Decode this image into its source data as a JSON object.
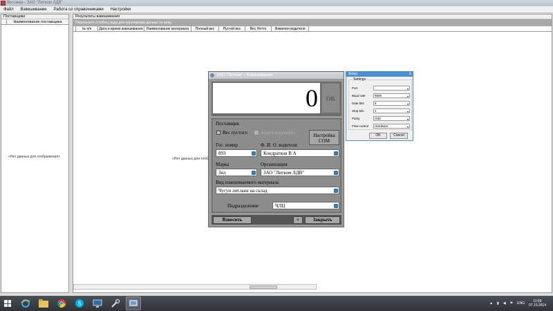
{
  "app": {
    "title": "Весовая - ЗАО \"Литком ЛДВ\"",
    "menu": [
      "Файл",
      "Взвешивание",
      "Работа со справочниками",
      "Настройки"
    ]
  },
  "suppliers": {
    "caption": "Поставщики",
    "column": "Наименование поставщика",
    "empty": "<Нет данных для отображения>"
  },
  "results": {
    "caption": "Результаты взвешивания",
    "group_hint": "Перенесите столбец сюда для группировки данных по нему",
    "columns": [
      "№ п/п",
      "Дата и время взвешивания",
      "Наименование материала",
      "Полный вес",
      "Пустой вес",
      "Вес Нетто",
      "Фамилия водителя"
    ],
    "empty": "<Нет данных для отоб"
  },
  "weigh_dialog": {
    "title": "ЗАО \"Литком\" - Взвешивание",
    "weight": "0",
    "ok": "OK",
    "section": "Поставщик",
    "empty_weight": "Вес пустого",
    "manual": "Задать в ручную",
    "com_button_l1": "Настройка",
    "com_button_l2": "COM",
    "gos_label": "Гос. номер",
    "gos_value": "893",
    "driver_label": "Ф. И. О. водителя",
    "driver_value": "Кондратков  В А",
    "brand_label": "Марка",
    "brand_value": "Зил",
    "org_label": "Организация",
    "org_value": "ЗАО \"Литком ЛДВ\"",
    "material_label": "Вид взвешиваемого материала",
    "material_value": "Чугун лит.наш на  склад",
    "division_label": "Подразделение",
    "division_value": "ЧЛЦ",
    "weigh_button": "Взвесить",
    "plus_button": "+",
    "close_button": "Закрыть"
  },
  "setup_dialog": {
    "title": "Setup",
    "close": "x",
    "group": "Settings",
    "rows": [
      {
        "label": "Port",
        "value": ""
      },
      {
        "label": "Baud rate",
        "value": "9600"
      },
      {
        "label": "Data bits",
        "value": "8"
      },
      {
        "label": "Stop bits",
        "value": "1"
      },
      {
        "label": "Parity",
        "value": "Odd"
      },
      {
        "label": "Flow control",
        "value": "Hardware"
      }
    ],
    "ok": "OK",
    "cancel": "Cancel"
  },
  "taskbar": {
    "lang": "ENG",
    "time": "11:59",
    "date": "07.10.2014",
    "icons": [
      "windows-icon",
      "ie-icon",
      "explorer-icon",
      "chrome-icon",
      "skype-icon",
      "monitor-icon",
      "tools-icon",
      "scales-app-icon"
    ]
  },
  "colors": {
    "dialog_bg": "#9a9a9a",
    "dropdown_accent": "#1a5ea1",
    "setup_titlebar": "#4a90d2",
    "taskbar": "#2f3338"
  }
}
